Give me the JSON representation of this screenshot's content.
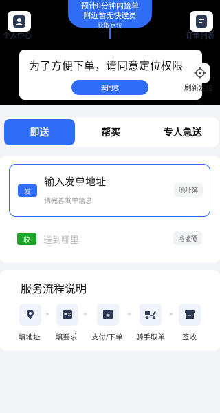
{
  "header": {
    "left_label": "个人中心",
    "right_label": "订单列表",
    "bubble_title": "预计0分钟内接单",
    "bubble_line2": "附近暂无快送员",
    "bubble_line3": "获取定位"
  },
  "permission": {
    "message": "为了方便下单，请同意定位权限",
    "button": "去同意"
  },
  "locate": {
    "label": "刷新定位"
  },
  "tabs": [
    "即送",
    "帮买",
    "专人急送"
  ],
  "address": {
    "send_tag": "发",
    "send_title": "输入发单地址",
    "send_sub": "请完善发单信息",
    "book_label": "地址簿",
    "recv_tag": "收",
    "recv_placeholder": "送到哪里"
  },
  "process": {
    "title": "服务流程说明",
    "arrow": "»",
    "steps": [
      {
        "label": "填地址",
        "icon": "location-pin-icon"
      },
      {
        "label": "填要求",
        "icon": "form-card-icon"
      },
      {
        "label": "支付/下单",
        "icon": "yuan-icon"
      },
      {
        "label": "骑手取单",
        "icon": "scooter-icon"
      },
      {
        "label": "签收",
        "icon": "package-icon"
      }
    ]
  },
  "colors": {
    "accent": "#2f6df6",
    "recv": "#21a129"
  }
}
